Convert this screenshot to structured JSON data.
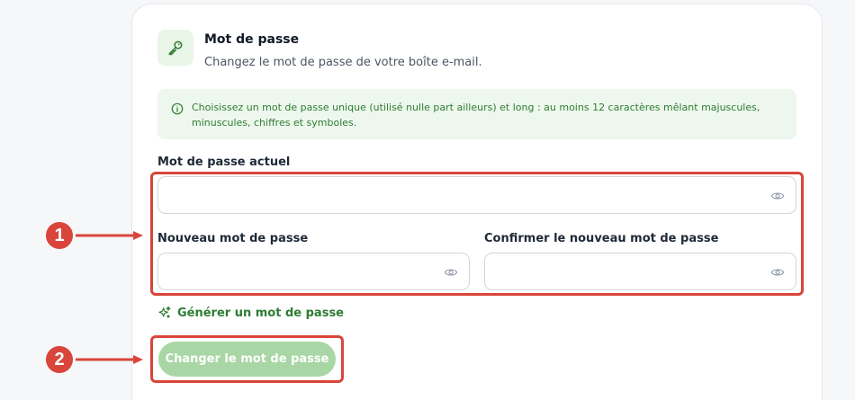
{
  "section": {
    "title": "Mot de passe",
    "subtitle": "Changez le mot de passe de votre boîte e-mail.",
    "icon": "key-icon"
  },
  "info": {
    "icon": "info-icon",
    "text": "Choisissez un mot de passe unique (utilisé nulle part ailleurs) et long : au moins 12 caractères mêlant majuscules, minuscules, chiffres et symboles."
  },
  "form": {
    "current_label": "Mot de passe actuel",
    "current_value": "",
    "new_label": "Nouveau mot de passe",
    "new_value": "",
    "confirm_label": "Confirmer le nouveau mot de passe",
    "confirm_value": "",
    "generate_label": "Générer un mot de passe",
    "submit_label": "Changer le mot de passe"
  },
  "annotations": {
    "marker_1": "1",
    "marker_2": "2"
  },
  "colors": {
    "accent_green": "#2e7d32",
    "button_disabled_green": "#a9d6a5",
    "info_background": "#eef7ed",
    "annotation_red": "#d9453a"
  }
}
